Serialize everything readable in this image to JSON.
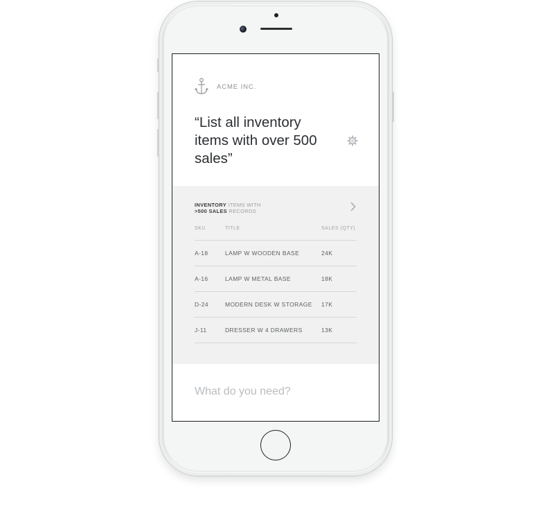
{
  "app": {
    "brand_name": "ACME INC.",
    "brand_icon": "anchor-icon"
  },
  "query": {
    "text": "“List all inventory items with over 500 sales”",
    "settings_icon": "gear-icon"
  },
  "results": {
    "title_bold_1": "INVENTORY",
    "title_rest_1": " ITEMS WITH",
    "title_bold_2": ">500 SALES",
    "title_rest_2": " RECORDS",
    "expand_icon": "chevron-right-icon",
    "columns": {
      "sku": "SKU",
      "title": "TITLE",
      "sales": "SALES (QTY)"
    },
    "rows": [
      {
        "sku": "A-18",
        "title": "LAMP W WOODEN BASE",
        "sales": "24K"
      },
      {
        "sku": "A-16",
        "title": "LAMP W METAL BASE",
        "sales": "18K"
      },
      {
        "sku": "D-24",
        "title": "MODERN DESK W STORAGE",
        "sales": "17K"
      },
      {
        "sku": "J-11",
        "title": "DRESSER W 4 DRAWERS",
        "sales": "13K"
      }
    ]
  },
  "input": {
    "value": "",
    "placeholder": "What do you need?"
  },
  "colors": {
    "text_dark": "#2c2e31",
    "text_muted": "#8e9194",
    "results_bg": "#f1f1f1",
    "divider": "#d4d6d8"
  }
}
